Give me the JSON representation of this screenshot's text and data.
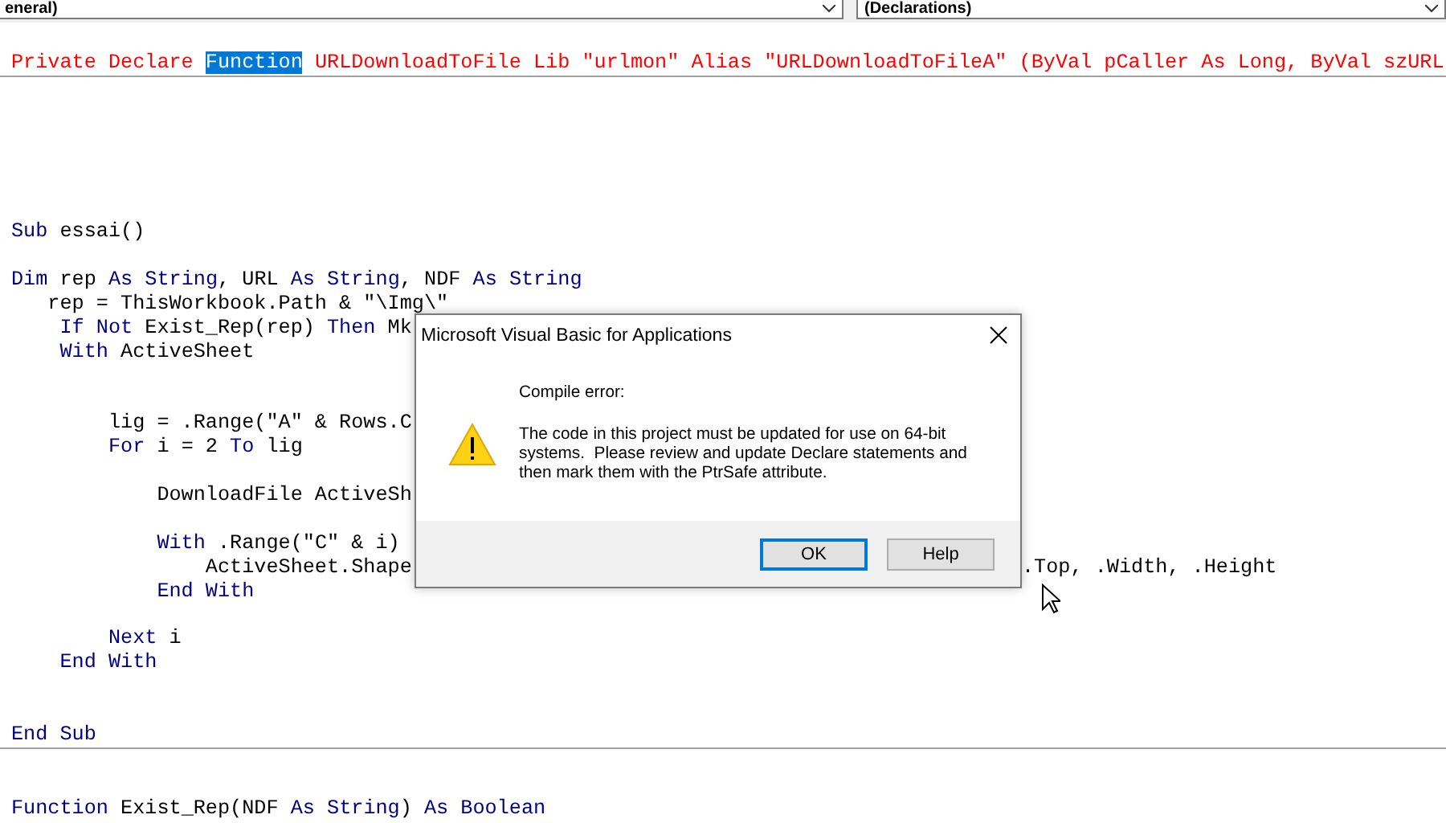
{
  "combos": [
    {
      "label": "eneral)"
    },
    {
      "label": "(Declarations)"
    }
  ],
  "code_lines": [
    {
      "kind": "code",
      "tokens": [
        {
          "text": "Private Declare ",
          "kind": "error"
        },
        {
          "text": "Function",
          "kind": "selected"
        },
        {
          "text": " URLDownloadToFile Lib \"urlmon\" Alias \"URLDownloadToFileA\" (ByVal pCaller As Long, ByVal szURL",
          "kind": "error"
        }
      ]
    },
    {
      "kind": "blank",
      "separator_above": true
    },
    {
      "kind": "blank"
    },
    {
      "kind": "blank"
    },
    {
      "kind": "blank"
    },
    {
      "kind": "blank"
    },
    {
      "kind": "blank"
    },
    {
      "kind": "code",
      "tokens": [
        {
          "text": "Sub",
          "kind": "keyword"
        },
        {
          "text": " essai()",
          "kind": "text"
        }
      ]
    },
    {
      "kind": "blank"
    },
    {
      "kind": "code",
      "tokens": [
        {
          "text": "Dim",
          "kind": "keyword"
        },
        {
          "text": " rep ",
          "kind": "text"
        },
        {
          "text": "As String",
          "kind": "keyword"
        },
        {
          "text": ", URL ",
          "kind": "text"
        },
        {
          "text": "As String",
          "kind": "keyword"
        },
        {
          "text": ", NDF ",
          "kind": "text"
        },
        {
          "text": "As String",
          "kind": "keyword"
        }
      ]
    },
    {
      "kind": "code",
      "tokens": [
        {
          "text": "   rep = ThisWorkbook.Path & \"\\Img\\\"",
          "kind": "text"
        }
      ]
    },
    {
      "kind": "code",
      "tokens": [
        {
          "text": "    If Not",
          "kind": "keyword"
        },
        {
          "text": " Exist_Rep(rep) ",
          "kind": "text"
        },
        {
          "text": "Then",
          "kind": "keyword"
        },
        {
          "text": " Mk",
          "kind": "text"
        }
      ]
    },
    {
      "kind": "code",
      "tokens": [
        {
          "text": "    With",
          "kind": "keyword"
        },
        {
          "text": " ActiveSheet",
          "kind": "text"
        }
      ]
    },
    {
      "kind": "blank"
    },
    {
      "kind": "blank"
    },
    {
      "kind": "code",
      "tokens": [
        {
          "text": "        lig = .Range(\"A\" & Rows.C",
          "kind": "text"
        }
      ]
    },
    {
      "kind": "code",
      "tokens": [
        {
          "text": "        For",
          "kind": "keyword"
        },
        {
          "text": " i = 2 ",
          "kind": "text"
        },
        {
          "text": "To",
          "kind": "keyword"
        },
        {
          "text": " lig",
          "kind": "text"
        }
      ]
    },
    {
      "kind": "blank"
    },
    {
      "kind": "code",
      "tokens": [
        {
          "text": "            DownloadFile ActiveSh",
          "kind": "text"
        }
      ]
    },
    {
      "kind": "blank"
    },
    {
      "kind": "code",
      "tokens": [
        {
          "text": "            With",
          "kind": "keyword"
        },
        {
          "text": " .Range(\"C\" & i)",
          "kind": "text"
        }
      ]
    },
    {
      "kind": "code",
      "tokens": [
        {
          "text": "                ActiveSheet.Shape",
          "kind": "text"
        }
      ],
      "tail": ".Top, .Width, .Height"
    },
    {
      "kind": "code",
      "tokens": [
        {
          "text": "            End With",
          "kind": "keyword"
        }
      ]
    },
    {
      "kind": "blank"
    },
    {
      "kind": "code",
      "tokens": [
        {
          "text": "        Next",
          "kind": "keyword"
        },
        {
          "text": " i",
          "kind": "text"
        }
      ]
    },
    {
      "kind": "code",
      "tokens": [
        {
          "text": "    End With",
          "kind": "keyword"
        }
      ]
    },
    {
      "kind": "blank"
    },
    {
      "kind": "blank"
    },
    {
      "kind": "code",
      "tokens": [
        {
          "text": "End Sub",
          "kind": "keyword"
        }
      ]
    },
    {
      "kind": "blank",
      "separator_above": true
    },
    {
      "kind": "blank"
    },
    {
      "kind": "code",
      "tokens": [
        {
          "text": "Function",
          "kind": "keyword"
        },
        {
          "text": " Exist_Rep(NDF ",
          "kind": "text"
        },
        {
          "text": "As String",
          "kind": "keyword"
        },
        {
          "text": ") ",
          "kind": "text"
        },
        {
          "text": "As Boolean",
          "kind": "keyword"
        }
      ]
    }
  ],
  "dialog": {
    "title": "Microsoft Visual Basic for Applications",
    "heading": "Compile error:",
    "message": "The code in this project must be updated for use on 64-bit systems.  Please review and update Declare statements and then mark them with the PtrSafe attribute.",
    "buttons": [
      {
        "label": "OK",
        "default": true
      },
      {
        "label": "Help",
        "default": false
      }
    ]
  }
}
